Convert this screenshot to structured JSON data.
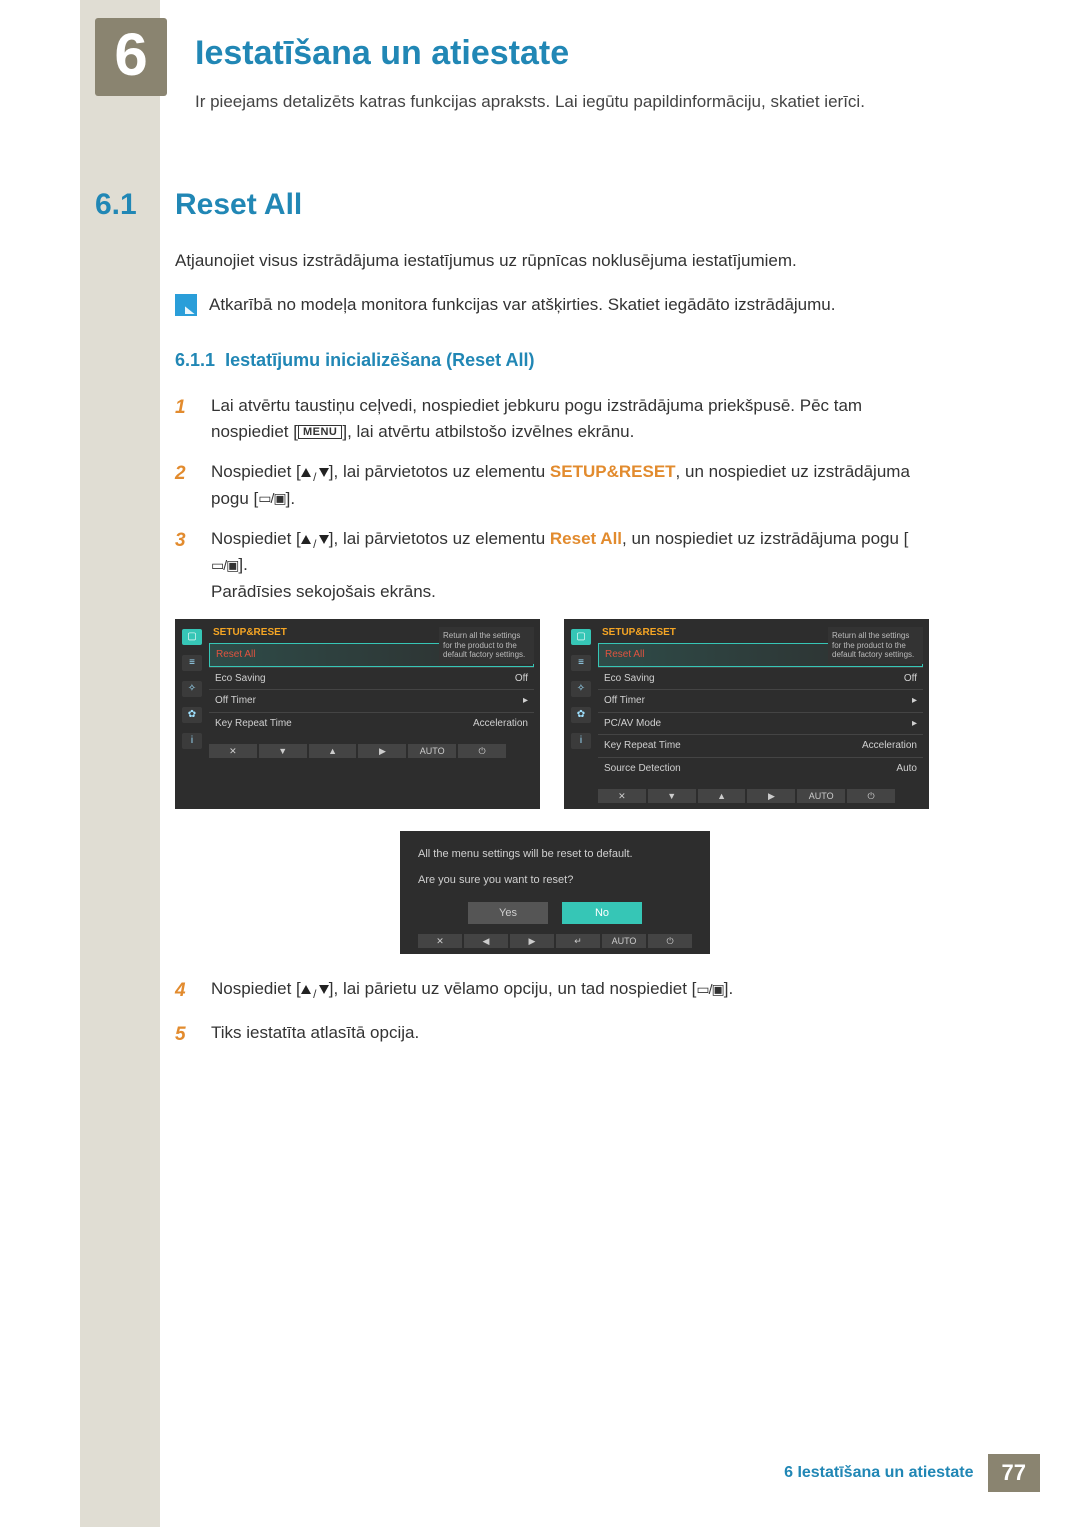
{
  "chapter": {
    "number": "6",
    "title": "Iestatīšana un atiestate",
    "subtitle": "Ir pieejams detalizēts katras funkcijas apraksts. Lai iegūtu papildinformāciju, skatiet ierīci."
  },
  "section": {
    "number": "6.1",
    "title": "Reset All",
    "intro": "Atjaunojiet visus izstrādājuma iestatījumus uz rūpnīcas noklusējuma iestatījumiem.",
    "note": "Atkarībā no modeļa monitora funkcijas var atšķirties. Skatiet iegādāto izstrādājumu."
  },
  "subsection": {
    "number": "6.1.1",
    "title": "Iestatījumu inicializēšana (Reset All)"
  },
  "steps": {
    "s1a": "Lai atvērtu taustiņu ceļvedi, nospiediet jebkuru pogu izstrādājuma priekšpusē. Pēc tam nospiediet [",
    "s1_menu": "MENU",
    "s1b": "], lai atvērtu atbilstošo izvēlnes ekrānu.",
    "s2a": "Nospiediet [",
    "s2b": "], lai pārvietotos uz elementu ",
    "s2_hl": "SETUP&RESET",
    "s2c": ", un nospiediet uz izstrādājuma pogu [",
    "s2d": "].",
    "s3a": "Nospiediet [",
    "s3b": "], lai pārvietotos uz elementu ",
    "s3_hl": "Reset All",
    "s3c": ", un nospiediet uz izstrādājuma pogu [",
    "s3d": "].",
    "s3_caption": "Parādīsies sekojošais ekrāns.",
    "s4a": "Nospiediet [",
    "s4b": "], lai pārietu uz vēlamo opciju, un tad nospiediet [",
    "s4c": "].",
    "s5": "Tiks iestatīta atlasītā opcija."
  },
  "osd": {
    "title": "SETUP&RESET",
    "tip": "Return all the settings for the product to the default factory settings.",
    "menu1": [
      {
        "label": "Reset All",
        "value": ""
      },
      {
        "label": "Eco Saving",
        "value": "Off"
      },
      {
        "label": "Off Timer",
        "value": "▸"
      },
      {
        "label": "Key Repeat Time",
        "value": "Acceleration"
      }
    ],
    "menu2": [
      {
        "label": "Reset All",
        "value": ""
      },
      {
        "label": "Eco Saving",
        "value": "Off"
      },
      {
        "label": "Off Timer",
        "value": "▸"
      },
      {
        "label": "PC/AV Mode",
        "value": "▸"
      },
      {
        "label": "Key Repeat Time",
        "value": "Acceleration"
      },
      {
        "label": "Source Detection",
        "value": "Auto"
      }
    ],
    "foot": [
      "✕",
      "▼",
      "▲",
      "▶",
      "AUTO",
      "⏻"
    ]
  },
  "confirm": {
    "line1": "All the menu settings will be reset to default.",
    "line2": "Are you sure you want to reset?",
    "yes": "Yes",
    "no": "No",
    "foot": [
      "✕",
      "◀",
      "▶",
      "↵",
      "AUTO",
      "⏻"
    ]
  },
  "footer": {
    "label": "6 Iestatīšana un atiestate",
    "page": "77"
  }
}
